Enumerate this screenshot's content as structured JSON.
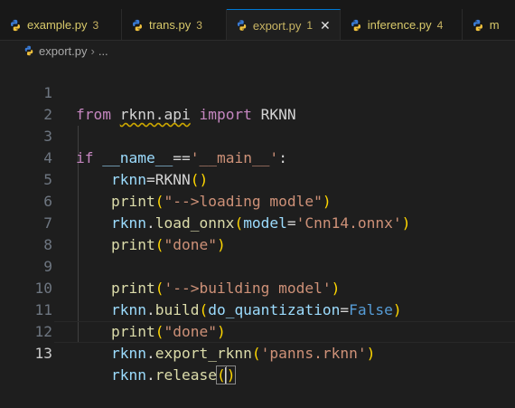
{
  "tabs": [
    {
      "label": "example.py",
      "count": "3"
    },
    {
      "label": "trans.py",
      "count": "3"
    },
    {
      "label": "export.py",
      "count": "1",
      "close": "✕"
    },
    {
      "label": "inference.py",
      "count": "4"
    },
    {
      "label": "m"
    }
  ],
  "breadcrumb": {
    "file": "export.py",
    "sep": "›",
    "more": "..."
  },
  "editor": {
    "line_numbers": [
      "1",
      "2",
      "3",
      "4",
      "5",
      "6",
      "7",
      "8",
      "9",
      "10",
      "11",
      "12",
      "13"
    ],
    "current_line": "13"
  },
  "colors": {
    "keyword": "#c586c0",
    "string": "#ce9178",
    "function": "#dcdcaa",
    "variable": "#9cdcfe",
    "bracket1": "#ffd700",
    "bracket2": "#da70d6",
    "constant": "#569cd6"
  }
}
